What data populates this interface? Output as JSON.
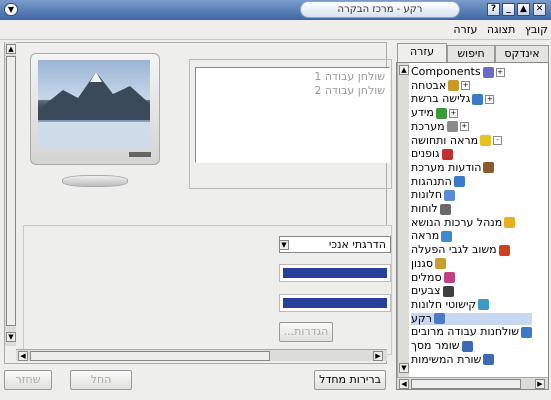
{
  "window": {
    "title": "רקע - מרכז הבקרה",
    "buttons": [
      "?",
      "_",
      "▲",
      "✕"
    ]
  },
  "menubar": {
    "items": [
      "קובץ",
      "תצוגה",
      "עזרה"
    ]
  },
  "sidebar": {
    "tabs": [
      "אינדקס",
      "חיפוש",
      "עזרה"
    ],
    "active_tab": "עזרה",
    "tree": [
      {
        "label": "Components",
        "icon": "components-icon",
        "color": "#6a6ac8",
        "level": 0,
        "expander": "+"
      },
      {
        "label": "אבטחה",
        "icon": "lock-icon",
        "color": "#c89a2a",
        "level": 0,
        "expander": "+"
      },
      {
        "label": "גלישה ברשת",
        "icon": "network-icon",
        "color": "#3a7ac8",
        "level": 0,
        "expander": "+"
      },
      {
        "label": "מידע",
        "icon": "info-icon",
        "color": "#3a9a3a",
        "level": 0,
        "expander": "+"
      },
      {
        "label": "מערכת",
        "icon": "system-icon",
        "color": "#8a8a8a",
        "level": 0,
        "expander": "+"
      },
      {
        "label": "מראה ותחושה",
        "icon": "appearance-icon",
        "color": "#e8c020",
        "level": 0,
        "expander": "-"
      },
      {
        "label": "גופנים",
        "icon": "fonts-icon",
        "color": "#c03030",
        "level": 1,
        "expander": ""
      },
      {
        "label": "הודעות מערכת",
        "icon": "notifications-icon",
        "color": "#8a5a2a",
        "level": 1,
        "expander": ""
      },
      {
        "label": "התנהגות",
        "icon": "behavior-icon",
        "color": "#3a7ac8",
        "level": 1,
        "expander": ""
      },
      {
        "label": "חלונות",
        "icon": "windows-icon",
        "color": "#5a8ad8",
        "level": 1,
        "expander": ""
      },
      {
        "label": "לוחות",
        "icon": "panels-icon",
        "color": "#6a6a6a",
        "level": 1,
        "expander": ""
      },
      {
        "label": "מנהל ערכות הנושא",
        "icon": "theme-manager-icon",
        "color": "#e8b020",
        "level": 1,
        "expander": ""
      },
      {
        "label": "מראה",
        "icon": "style-icon",
        "color": "#3a8ad8",
        "level": 1,
        "expander": ""
      },
      {
        "label": "משוב לגבי הפעלה",
        "icon": "launch-feedback-icon",
        "color": "#d04020",
        "level": 1,
        "expander": ""
      },
      {
        "label": "סגנון",
        "icon": "style-palette-icon",
        "color": "#c8a030",
        "level": 1,
        "expander": ""
      },
      {
        "label": "סמלים",
        "icon": "icons-icon",
        "color": "#c04080",
        "level": 1,
        "expander": ""
      },
      {
        "label": "צבעים",
        "icon": "colors-icon",
        "color": "#404040",
        "level": 1,
        "expander": ""
      },
      {
        "label": "קישוטי חלונות",
        "icon": "window-decorations-icon",
        "color": "#3a9ac8",
        "level": 1,
        "expander": ""
      },
      {
        "label": "רקע",
        "icon": "background-icon",
        "color": "#4a7ac8",
        "level": 1,
        "expander": "",
        "selected": true
      },
      {
        "label": "שולחנות עבודה מרובים",
        "icon": "multiple-desktops-icon",
        "color": "#3a7ac8",
        "level": 1,
        "expander": ""
      },
      {
        "label": "שומר מסך",
        "icon": "screensaver-icon",
        "color": "#3a6ab8",
        "level": 1,
        "expander": ""
      },
      {
        "label": "שורת המשימות",
        "icon": "taskbar-icon",
        "color": "#3a6ab8",
        "level": 1,
        "expander": ""
      }
    ]
  },
  "main": {
    "desktops": [
      "שולחן עבודה 1",
      "שולחן עבודה 2"
    ],
    "gradient_select": "הדרגתי אנכי",
    "color1": "#2a3f9a",
    "color2": "#2a3f9a",
    "settings_button": "הגדרות...",
    "default_button": "ברירות מחדל",
    "apply_button": "החל",
    "reset_button": "שחזר"
  }
}
